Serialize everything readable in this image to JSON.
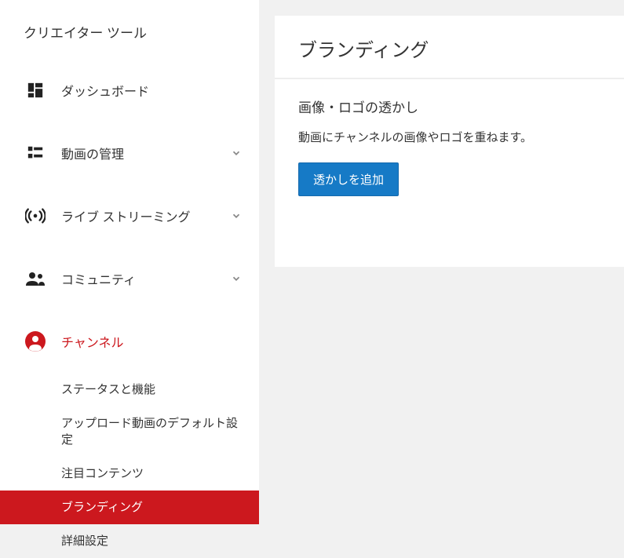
{
  "sidebar": {
    "title": "クリエイター ツール",
    "items": [
      {
        "label": "ダッシュボード"
      },
      {
        "label": "動画の管理"
      },
      {
        "label": "ライブ ストリーミング"
      },
      {
        "label": "コミュニティ"
      },
      {
        "label": "チャンネル"
      }
    ],
    "sub_items": [
      {
        "label": "ステータスと機能"
      },
      {
        "label": "アップロード動画のデフォルト設定"
      },
      {
        "label": "注目コンテンツ"
      },
      {
        "label": "ブランディング"
      },
      {
        "label": "詳細設定"
      }
    ]
  },
  "main": {
    "card_title": "ブランディング",
    "section_title": "画像・ロゴの透かし",
    "section_desc": "動画にチャンネルの画像やロゴを重ねます。",
    "button_label": "透かしを追加"
  },
  "colors": {
    "brand_red": "#cc181e",
    "button_blue": "#167ac6"
  }
}
